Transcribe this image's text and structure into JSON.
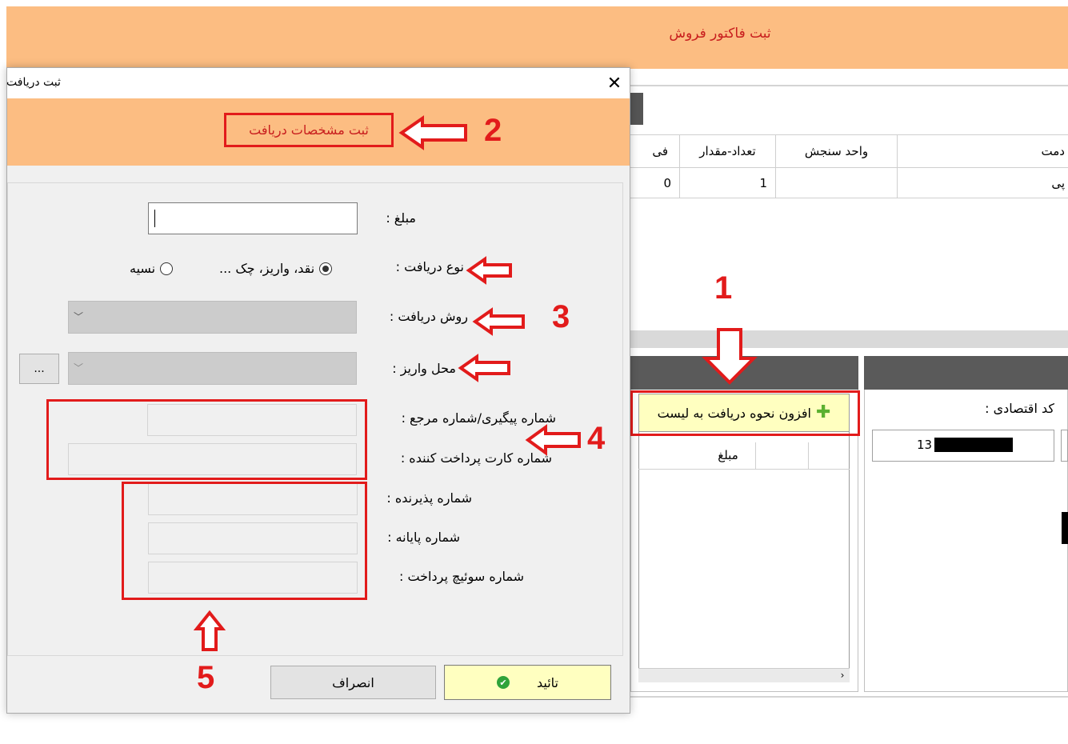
{
  "app": {
    "title": "ثبت فاکتور فروش",
    "grid_headers": [
      "فی",
      "تعداد-مقدار",
      "واحد سنجش",
      "دمت"
    ],
    "grid_row": [
      "0",
      "1",
      "",
      "پی"
    ],
    "add_payment_button": "افزون نحوه دریافت به لیست",
    "payments_col_header": "مبلغ",
    "economic_code_label": "کد اقتصادی :",
    "economic_code_value": "13"
  },
  "dialog": {
    "title": "ثبت دریافت",
    "header": "ثبت مشخصات دریافت",
    "amount_label": "مبلغ :",
    "receive_type_label": "نوع دریافت :",
    "option_cash": "نقد، واریز، چک ...",
    "option_credit": "نسیه",
    "receive_method_label": "روش دریافت :",
    "deposit_place_label": "محل واریز :",
    "browse_button": "...",
    "tracking_label": "شماره پیگیری/شماره مرجع :",
    "payer_card_label": "شماره کارت پرداخت کننده :",
    "acceptor_label": "شماره پذیرنده :",
    "terminal_label": "شماره پایانه :",
    "switch_label": "شماره سوئیچ پرداخت :",
    "confirm_button": "تائید",
    "cancel_button": "انصراف"
  },
  "callouts": [
    "1",
    "2",
    "3",
    "4",
    "5"
  ],
  "colors": {
    "header_bg": "#fcbd82",
    "accent_red": "#e21b1b",
    "confirm_bg": "#ffffc0"
  }
}
